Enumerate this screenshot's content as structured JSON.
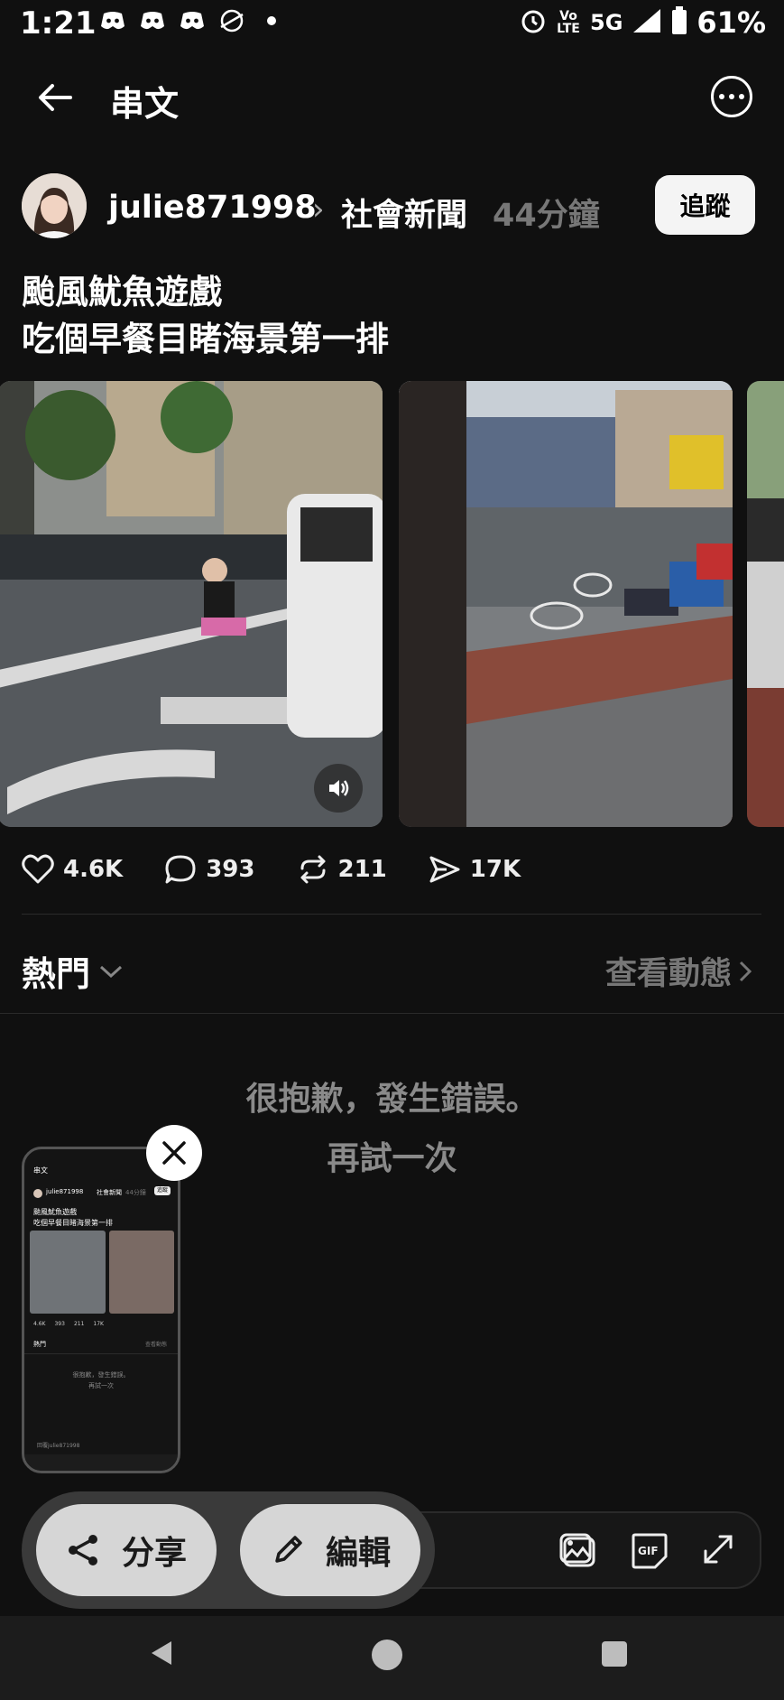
{
  "status_bar": {
    "time": "1:21",
    "network": "5G",
    "volte": "Vo LTE",
    "battery": "61%",
    "notification_icons": [
      "discord-icon",
      "discord-icon",
      "discord-icon",
      "nasa-icon",
      "dot-icon"
    ],
    "system_icons": [
      "alarm-icon",
      "volte-icon",
      "signal-icon",
      "battery-icon"
    ]
  },
  "header": {
    "title": "串文"
  },
  "post": {
    "username": "julie871998",
    "topic": "社會新聞",
    "time": "44分鐘",
    "follow_label": "追蹤",
    "text_line1": "颱風魷魚遊戲",
    "text_line2": "吃個早餐目睹海景第一排",
    "stats": {
      "likes": "4.6K",
      "comments": "393",
      "reposts": "211",
      "shares": "17K"
    }
  },
  "hot_section": {
    "label": "熱門",
    "view_activity": "查看動態",
    "error_message": "很抱歉，發生錯誤。",
    "retry_label": "再試一次"
  },
  "thumbnail": {
    "header": "串文",
    "username": "julie871998",
    "topic": "社會新聞",
    "time": "44分鐘",
    "follow": "追蹤",
    "line1": "颱風魷魚遊戲",
    "line2": "吃個早餐目睹海景第一排",
    "likes": "4.6K",
    "comments": "393",
    "reposts": "211",
    "shares": "17K",
    "hot": "熱門",
    "view": "查看動態",
    "error": "很抱歉，發生錯誤。",
    "retry": "再試一次",
    "reply_placeholder": "回覆julie871998"
  },
  "screenshot_actions": {
    "share_label": "分享",
    "edit_label": "編輯"
  },
  "colors": {
    "background": "#101010",
    "muted_text": "#777777",
    "follow_bg": "#f4f4f4",
    "pill_bg": "#d6d6d6"
  }
}
